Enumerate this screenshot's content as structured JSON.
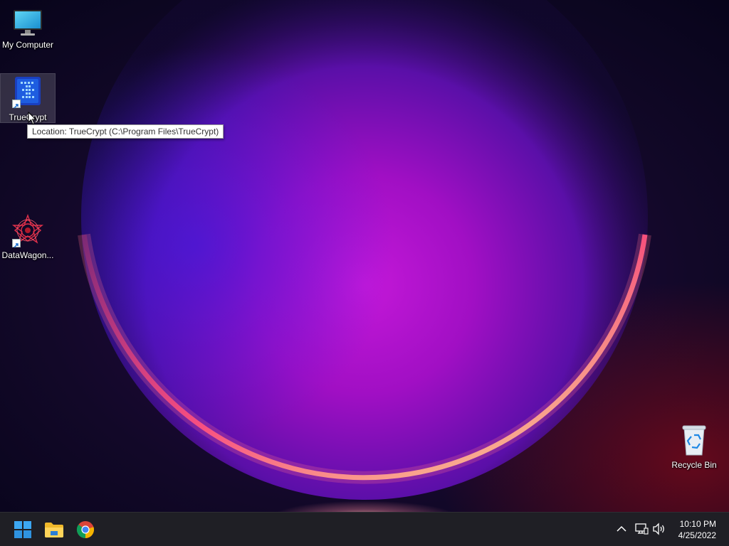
{
  "desktop": {
    "icons": [
      {
        "label": "My Computer",
        "icon": "monitor-icon"
      },
      {
        "label": "TrueCrypt",
        "icon": "truecrypt-icon",
        "shortcut": true,
        "selected": true
      },
      {
        "label": "DataWagon...",
        "icon": "datawagon-icon",
        "shortcut": true
      },
      {
        "label": "Recycle Bin",
        "icon": "recycle-bin-icon"
      }
    ],
    "tooltip": "Location: TrueCrypt (C:\\Program Files\\TrueCrypt)"
  },
  "taskbar": {
    "pinned": [
      {
        "name": "Start",
        "icon": "windows-start-icon"
      },
      {
        "name": "File Explorer",
        "icon": "folder-icon"
      },
      {
        "name": "Google Chrome",
        "icon": "chrome-icon"
      }
    ],
    "tray": {
      "icons": [
        "chevron-up-icon",
        "network-icon",
        "volume-icon"
      ]
    },
    "clock": {
      "time": "10:10 PM",
      "date": "4/25/2022"
    }
  },
  "colors": {
    "taskbar": "#1f1f25",
    "wallpaper_dark": "#0b0620",
    "wallpaper_glow": "#b010c8",
    "wallpaper_ring": "#ff3a6a"
  }
}
